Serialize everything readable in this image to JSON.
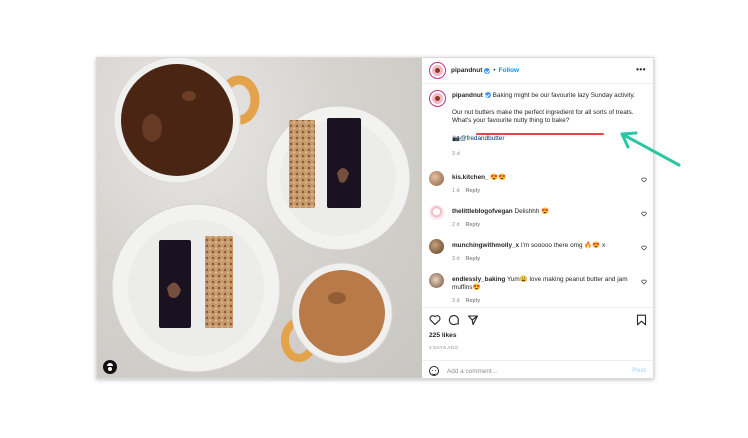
{
  "post": {
    "username": "pipandnut",
    "follow_label": "Follow",
    "separator": "•",
    "more_label": "•••"
  },
  "caption": {
    "username": "pipandnut",
    "line1": "Baking might be our favourite lazy Sunday activity.",
    "line2": "Our nut butters make the perfect ingredient for all sorts of treats. What's your favourite nutty thing to bake?",
    "credit": "📷@fredandbutter",
    "time": "3 d"
  },
  "comments": [
    {
      "username": "kis.kitchen_",
      "text": "😍😍",
      "time": "1 d",
      "reply": "Reply"
    },
    {
      "username": "thelittleblogofvegan",
      "text": "Delishhh 😍",
      "time": "2 d",
      "reply": "Reply"
    },
    {
      "username": "munchingwithmolly_x",
      "text": "I'm sooooo there omg 🔥😍 x",
      "time": "3 d",
      "reply": "Reply"
    },
    {
      "username": "endlessly_baking",
      "text": "Yum😩 love making peanut butter and jam muffins😍",
      "time": "3 d",
      "reply": "Reply"
    }
  ],
  "stats": {
    "likes": "225 likes",
    "ago": "3 DAYS AGO"
  },
  "composer": {
    "placeholder": "Add a comment...",
    "post_label": "Post"
  },
  "colors": {
    "accent_blue": "#0095f6",
    "annotation_red": "#e8424d",
    "annotation_arrow": "#2ec4a6"
  }
}
